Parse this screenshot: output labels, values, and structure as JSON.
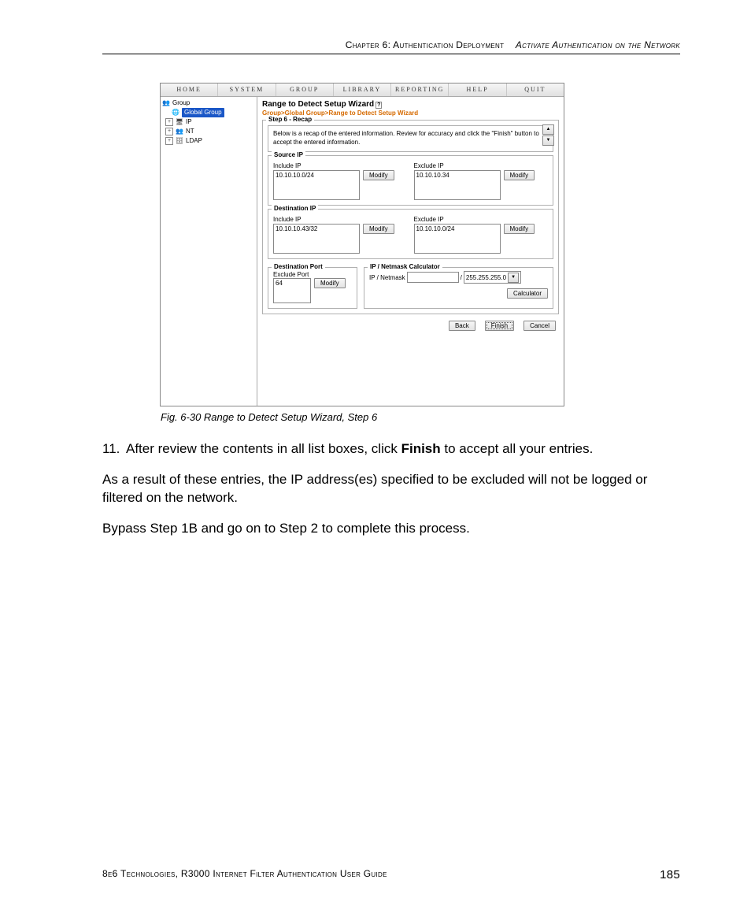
{
  "header": {
    "left": "Chapter 6: Authentication Deployment",
    "right": "Activate Authentication on the Network"
  },
  "menu": {
    "items": [
      "HOME",
      "SYSTEM",
      "GROUP",
      "LIBRARY",
      "REPORTING",
      "HELP",
      "QUIT"
    ]
  },
  "tree": {
    "root": "Group",
    "selected": "Global Group",
    "nodes": [
      "IP",
      "NT",
      "LDAP"
    ]
  },
  "wizard": {
    "title": "Range to Detect Setup Wizard",
    "breadcrumb": "Group>Global Group>Range to Detect Setup Wizard",
    "step_legend": "Step 6 - Recap",
    "recap_text": "Below is a recap of the entered information. Review for accuracy and click the \"Finish\" button to accept the entered information.",
    "source_legend": "Source IP",
    "dest_legend": "Destination IP",
    "include_label": "Include IP",
    "exclude_label": "Exclude IP",
    "source_include": "10.10.10.0/24",
    "source_exclude": "10.10.10.34",
    "dest_include": "10.10.10.43/32",
    "dest_exclude": "10.10.10.0/24",
    "modify": "Modify",
    "destport_legend": "Destination Port",
    "exclude_port_label": "Exclude Port",
    "exclude_port_value": "64",
    "calc_legend": "IP / Netmask Calculator",
    "calc_label": "IP / Netmask",
    "netmask_value": "255.255.255.0",
    "calc_button": "Calculator",
    "back": "Back",
    "finish": "Finish",
    "cancel": "Cancel"
  },
  "caption": "Fig. 6-30  Range to Detect Setup Wizard, Step 6",
  "body": {
    "step11_num": "11.",
    "step11_a": "After review the contents in all list boxes, click ",
    "step11_bold": "Finish",
    "step11_b": " to accept all your entries.",
    "para2": "As a result of these entries, the IP address(es) specified to be excluded will not be logged or filtered on the network.",
    "para3": "Bypass Step 1B and go on to Step 2 to complete this process."
  },
  "footer": {
    "left": "8e6 Technologies, R3000 Internet Filter Authentication User Guide",
    "page": "185"
  }
}
